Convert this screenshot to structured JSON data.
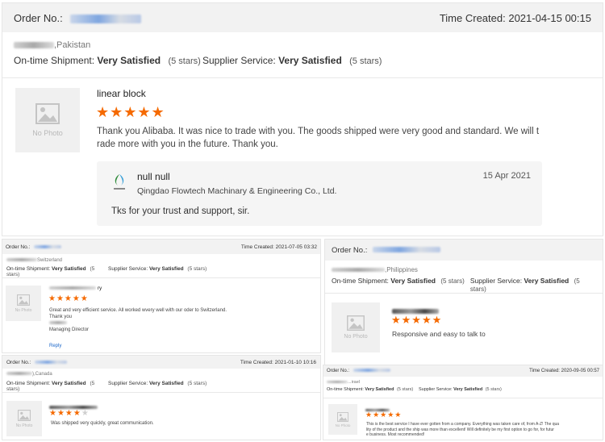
{
  "labels": {
    "order_no": "Order No.:",
    "time_created": "Time Created:",
    "on_time_shipment": "On-time Shipment:",
    "supplier_service": "Supplier Service:",
    "no_photo": "No Photo",
    "reply": "Reply"
  },
  "icons": {
    "star": "★",
    "no_photo": "image-placeholder-icon",
    "company_logo": "flowtech-logo-icon"
  },
  "colors": {
    "star": "#f56a00",
    "header_bg": "#f2f2f2",
    "link": "#1a66c9"
  },
  "review1": {
    "time_created": "2021-04-15 00:15",
    "country": ",Pakistan",
    "shipment": "Very Satisfied",
    "shipment_stars": "(5 stars)",
    "service": "Very Satisfied",
    "service_stars": "(5 stars)",
    "product": "linear block",
    "stars": "★★★★★",
    "comment_1": "Thank you Alibaba. It was nice to trade with you. The goods shipped were very good and standard. We will t",
    "comment_2": "rade more with you in the future. Thank you.",
    "reply_name": "null null",
    "reply_company": "Qingdao Flowtech Machinary & Engineering Co., Ltd.",
    "reply_date": "15 Apr 2021",
    "reply_text": "Tks for your trust and support, sir."
  },
  "review2": {
    "time_created": "2021-07-05 03:32",
    "country": "Switzerland",
    "shipment": "Very Satisfied",
    "shipment_stars": "(5 stars)",
    "service": "Very Satisfied",
    "service_stars": "(5 stars)",
    "product_suffix": "ry",
    "stars": "★★★★★",
    "comment_1": "Great and very efficient service. All worked wvery well with our oder to Switzerland.",
    "comment_2": "Thank you",
    "comment_3": "Managing Director"
  },
  "review3": {
    "country": ",Philippines",
    "shipment": "Very Satisfied",
    "shipment_stars": "(5 stars)",
    "service": "Very Satisfied",
    "service_stars": "(5 stars)",
    "stars": "★★★★★",
    "comment": "Responsive and easy to talk to"
  },
  "review4": {
    "time_created": "2021-01-10 10:16",
    "country": "),Canada",
    "shipment": "Very Satisfied",
    "shipment_stars": "(5 stars)",
    "service": "Very Satisfied",
    "service_stars": "(5 stars)",
    "stars_on": "★★★★",
    "stars_off": "★",
    "comment": "Was shipped very quickly, great communication."
  },
  "review5": {
    "time_created": "2020-09-05 00:57",
    "country": "...irael",
    "shipment": "Very Satisfied",
    "shipment_stars": "(5 stars)",
    "service": "Very Satisfied",
    "service_stars": "(5 stars)",
    "stars": "★★★★★",
    "comment_1": "This is the best service I have ever gotten from a company. Everything was taken care of, from A-Z! The qua",
    "comment_2": "lity of the product and the ship was more than excellent! Will definitely be my first option to go for, for futur",
    "comment_3": "e business. Most recommended!"
  }
}
